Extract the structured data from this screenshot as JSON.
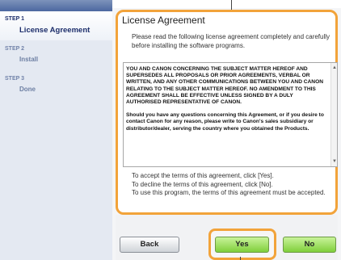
{
  "sidebar": {
    "steps": [
      {
        "number": "STEP 1",
        "label": "License Agreement"
      },
      {
        "number": "STEP 2",
        "label": "Install"
      },
      {
        "number": "STEP 3",
        "label": "Done"
      }
    ]
  },
  "license": {
    "title": "License Agreement",
    "intro": "Please read the following license agreement completely and carefully before installing the software programs.",
    "text_paragraph_1": "YOU AND CANON CONCERNING THE SUBJECT MATTER HEREOF AND SUPERSEDES ALL PROPOSALS OR PRIOR AGREEMENTS, VERBAL OR WRITTEN, AND ANY OTHER COMMUNICATIONS BETWEEN YOU AND CANON RELATING TO THE SUBJECT MATTER HEREOF.  NO AMENDMENT TO THIS AGREEMENT SHALL BE EFFECTIVE UNLESS SIGNED BY A DULY AUTHORISED REPRESENTATIVE OF CANON.",
    "text_paragraph_2": "Should you have any questions concerning this Agreement, or if you desire to contact Canon for any reason, please write to Canon's sales subsidiary or distributor/dealer, serving the country where you obtained the Products.",
    "instruction_1": "To accept the terms of this agreement, click [Yes].",
    "instruction_2": "To decline the terms of this agreement, click [No].",
    "instruction_3": "To use this program, the terms of this agreement must be accepted."
  },
  "buttons": {
    "back": "Back",
    "yes": "Yes",
    "no": "No"
  },
  "colors": {
    "highlight": "#f2a33a",
    "accept_button": "#7fcf3b",
    "sidebar_header": "#4c67a0"
  }
}
